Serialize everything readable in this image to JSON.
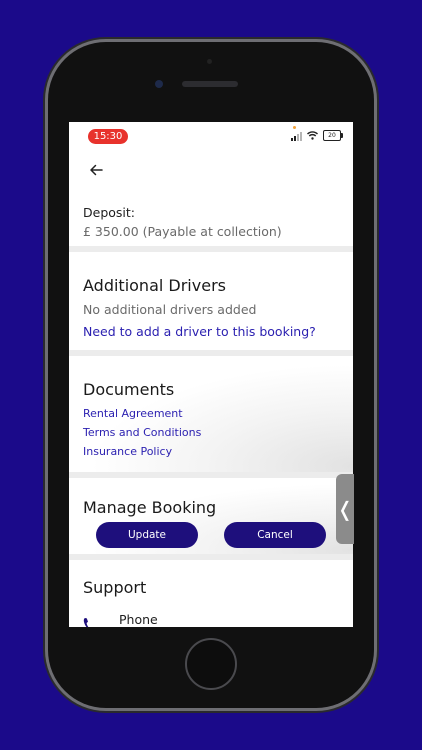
{
  "status_bar": {
    "time": "15:30",
    "battery": "20"
  },
  "nav": {
    "back_icon": "arrow-left-icon"
  },
  "deposit": {
    "label": "Deposit:",
    "value": "£ 350.00 (Payable at collection)"
  },
  "additional_drivers": {
    "title": "Additional Drivers",
    "empty_text": "No additional drivers added",
    "add_link": "Need to add a driver to this booking?"
  },
  "documents": {
    "title": "Documents",
    "links": [
      "Rental Agreement",
      "Terms and Conditions",
      "Insurance Policy"
    ]
  },
  "manage_booking": {
    "title": "Manage Booking",
    "update_label": "Update",
    "cancel_label": "Cancel"
  },
  "support": {
    "title": "Support",
    "phone_label": "Phone"
  },
  "drawer": {
    "glyph": "❬"
  },
  "colors": {
    "background": "#1b0a8a",
    "button": "#1e0f7c",
    "link": "#2a1fb0",
    "time_pill": "#e8322c"
  }
}
